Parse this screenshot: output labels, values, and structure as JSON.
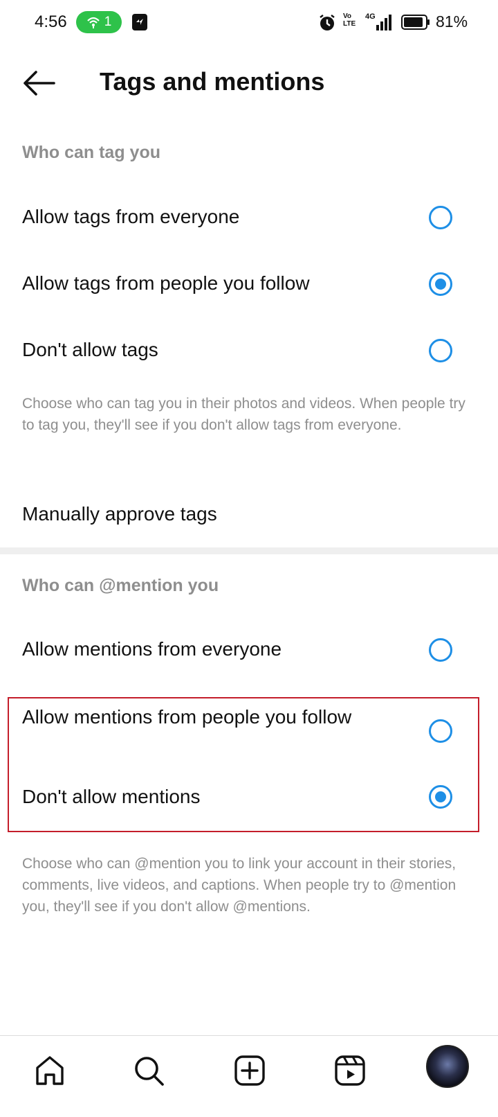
{
  "status_bar": {
    "time": "4:56",
    "hotspot_count": "1",
    "volte_line1": "Vo",
    "volte_line2": "LTE",
    "network": "4G",
    "battery": "81%"
  },
  "header": {
    "title": "Tags and mentions",
    "back_icon": "arrow-left-icon"
  },
  "tags_section": {
    "title": "Who can tag you",
    "options": [
      {
        "label": "Allow tags from everyone",
        "selected": false
      },
      {
        "label": "Allow tags from people you follow",
        "selected": true
      },
      {
        "label": "Don't allow tags",
        "selected": false
      }
    ],
    "helper": "Choose who can tag you in their photos and videos. When people try to tag you, they'll see if you don't allow tags from everyone.",
    "manual_approve": "Manually approve tags"
  },
  "mentions_section": {
    "title": "Who can @mention you",
    "options": [
      {
        "label": "Allow mentions from everyone",
        "selected": false
      },
      {
        "label": "Allow mentions from people you follow",
        "selected": false
      },
      {
        "label": "Don't allow mentions",
        "selected": true
      }
    ],
    "helper": "Choose who can @mention you to link your account in their stories, comments, live videos, and captions. When people try to @mention you, they'll see if you don't allow @mentions."
  },
  "bottom_nav": {
    "items": [
      "home-icon",
      "search-icon",
      "create-icon",
      "reels-icon",
      "profile-avatar"
    ]
  },
  "colors": {
    "accent": "#1e8fe6",
    "highlight": "#c41d2a",
    "secondary_text": "#8e8e8e",
    "hotspot": "#2ec24a"
  }
}
